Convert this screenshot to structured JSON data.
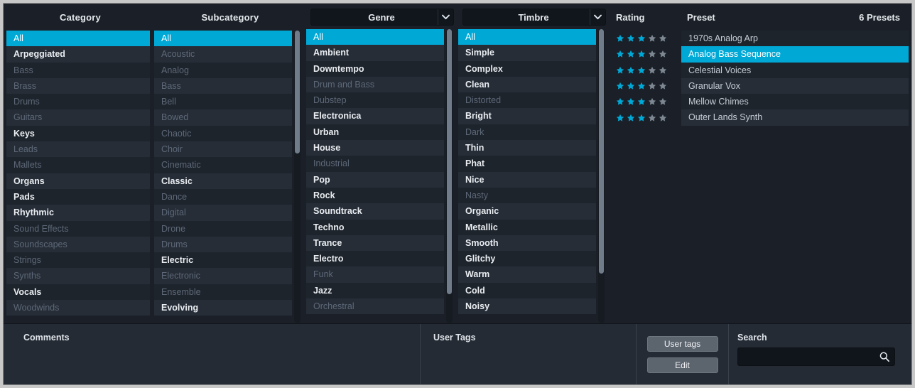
{
  "colors": {
    "accent": "#00a8d6",
    "panel_bg": "#1b2028",
    "row_bg": "#1e242c",
    "row_bg_alt": "#262d37",
    "star_on": "#00a8d6",
    "star_off": "#7d8792",
    "text_active": "#e9edf1",
    "text_inactive": "#5d6878",
    "button_bg": "#5c646e"
  },
  "columns": {
    "category": {
      "header": "Category",
      "has_dropdown": false,
      "scrollbar": false,
      "items": [
        {
          "label": "All",
          "state": "selected"
        },
        {
          "label": "Arpeggiated",
          "state": "active"
        },
        {
          "label": "Bass",
          "state": "inactive"
        },
        {
          "label": "Brass",
          "state": "inactive"
        },
        {
          "label": "Drums",
          "state": "inactive"
        },
        {
          "label": "Guitars",
          "state": "inactive"
        },
        {
          "label": "Keys",
          "state": "active"
        },
        {
          "label": "Leads",
          "state": "inactive"
        },
        {
          "label": "Mallets",
          "state": "inactive"
        },
        {
          "label": "Organs",
          "state": "active"
        },
        {
          "label": "Pads",
          "state": "active"
        },
        {
          "label": "Rhythmic",
          "state": "active"
        },
        {
          "label": "Sound Effects",
          "state": "inactive"
        },
        {
          "label": "Soundscapes",
          "state": "inactive"
        },
        {
          "label": "Strings",
          "state": "inactive"
        },
        {
          "label": "Synths",
          "state": "inactive"
        },
        {
          "label": "Vocals",
          "state": "active"
        },
        {
          "label": "Woodwinds",
          "state": "inactive"
        }
      ]
    },
    "subcategory": {
      "header": "Subcategory",
      "has_dropdown": false,
      "scrollbar": true,
      "scroll_thumb_pct": 42,
      "scroll_top_pct": 0,
      "items": [
        {
          "label": "All",
          "state": "selected"
        },
        {
          "label": "Acoustic",
          "state": "inactive"
        },
        {
          "label": "Analog",
          "state": "inactive"
        },
        {
          "label": "Bass",
          "state": "inactive"
        },
        {
          "label": "Bell",
          "state": "inactive"
        },
        {
          "label": "Bowed",
          "state": "inactive"
        },
        {
          "label": "Chaotic",
          "state": "inactive"
        },
        {
          "label": "Choir",
          "state": "inactive"
        },
        {
          "label": "Cinematic",
          "state": "inactive"
        },
        {
          "label": "Classic",
          "state": "active"
        },
        {
          "label": "Dance",
          "state": "inactive"
        },
        {
          "label": "Digital",
          "state": "inactive"
        },
        {
          "label": "Drone",
          "state": "inactive"
        },
        {
          "label": "Drums",
          "state": "inactive"
        },
        {
          "label": "Electric",
          "state": "active"
        },
        {
          "label": "Electronic",
          "state": "inactive"
        },
        {
          "label": "Ensemble",
          "state": "inactive"
        },
        {
          "label": "Evolving",
          "state": "active"
        }
      ]
    },
    "genre": {
      "header": "Genre",
      "has_dropdown": true,
      "scrollbar": true,
      "scroll_thumb_pct": 90,
      "scroll_top_pct": 0,
      "items": [
        {
          "label": "All",
          "state": "selected"
        },
        {
          "label": "Ambient",
          "state": "active"
        },
        {
          "label": "Downtempo",
          "state": "active"
        },
        {
          "label": "Drum and Bass",
          "state": "inactive"
        },
        {
          "label": "Dubstep",
          "state": "inactive"
        },
        {
          "label": "Electronica",
          "state": "active"
        },
        {
          "label": "Urban",
          "state": "active"
        },
        {
          "label": "House",
          "state": "active"
        },
        {
          "label": "Industrial",
          "state": "inactive"
        },
        {
          "label": "Pop",
          "state": "active"
        },
        {
          "label": "Rock",
          "state": "active"
        },
        {
          "label": "Soundtrack",
          "state": "active"
        },
        {
          "label": "Techno",
          "state": "active"
        },
        {
          "label": "Trance",
          "state": "active"
        },
        {
          "label": "Electro",
          "state": "active"
        },
        {
          "label": "Funk",
          "state": "inactive"
        },
        {
          "label": "Jazz",
          "state": "active"
        },
        {
          "label": "Orchestral",
          "state": "inactive"
        }
      ]
    },
    "timbre": {
      "header": "Timbre",
      "has_dropdown": true,
      "scrollbar": true,
      "scroll_thumb_pct": 83,
      "scroll_top_pct": 0,
      "items": [
        {
          "label": "All",
          "state": "selected"
        },
        {
          "label": "Simple",
          "state": "active"
        },
        {
          "label": "Complex",
          "state": "active"
        },
        {
          "label": "Clean",
          "state": "active"
        },
        {
          "label": "Distorted",
          "state": "inactive"
        },
        {
          "label": "Bright",
          "state": "active"
        },
        {
          "label": "Dark",
          "state": "inactive"
        },
        {
          "label": "Thin",
          "state": "active"
        },
        {
          "label": "Phat",
          "state": "active"
        },
        {
          "label": "Nice",
          "state": "active"
        },
        {
          "label": "Nasty",
          "state": "inactive"
        },
        {
          "label": "Organic",
          "state": "active"
        },
        {
          "label": "Metallic",
          "state": "active"
        },
        {
          "label": "Smooth",
          "state": "active"
        },
        {
          "label": "Glitchy",
          "state": "active"
        },
        {
          "label": "Warm",
          "state": "active"
        },
        {
          "label": "Cold",
          "state": "active"
        },
        {
          "label": "Noisy",
          "state": "active"
        }
      ]
    }
  },
  "presets": {
    "header_rating": "Rating",
    "header_preset": "Preset",
    "count_label": "6 Presets",
    "max_stars": 5,
    "items": [
      {
        "name": "1970s Analog Arp",
        "rating": 3,
        "selected": false
      },
      {
        "name": "Analog Bass Sequence",
        "rating": 3,
        "selected": true
      },
      {
        "name": "Celestial Voices",
        "rating": 3,
        "selected": false
      },
      {
        "name": "Granular Vox",
        "rating": 3,
        "selected": false
      },
      {
        "name": "Mellow Chimes",
        "rating": 3,
        "selected": false
      },
      {
        "name": "Outer Lands Synth",
        "rating": 3,
        "selected": false
      }
    ]
  },
  "bottom": {
    "comments_label": "Comments",
    "comments_value": "",
    "user_tags_label": "User Tags",
    "user_tags_value": "",
    "user_tags_button": "User tags",
    "edit_button": "Edit",
    "search_label": "Search",
    "search_value": "",
    "search_placeholder": ""
  }
}
